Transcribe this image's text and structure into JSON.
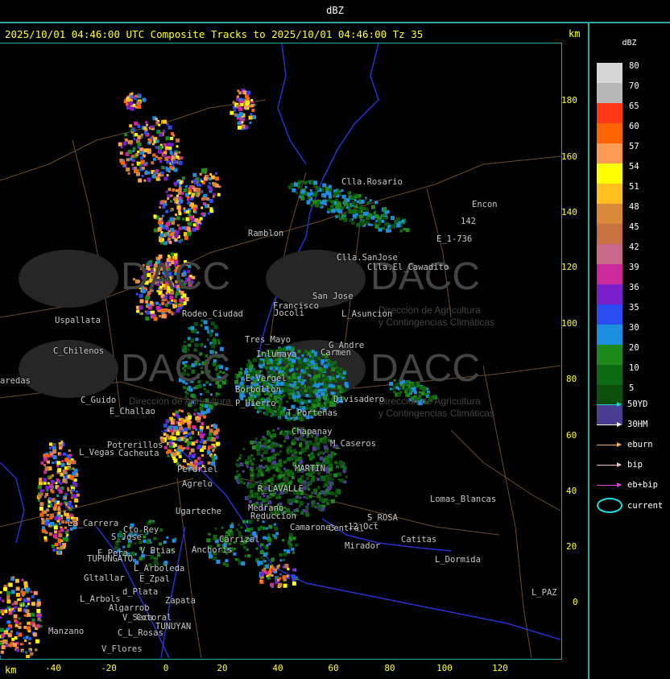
{
  "window": {
    "title": "dBZ"
  },
  "header": {
    "text": "2025/10/01 04:46:00 UTC Composite Tracks to 2025/10/01 04:46:00 Tz 35",
    "km_top": "km",
    "km_bottom": "km"
  },
  "axes": {
    "y_ticks": [
      {
        "label": "180"
      },
      {
        "label": "160"
      },
      {
        "label": "140"
      },
      {
        "label": "120"
      },
      {
        "label": "100"
      },
      {
        "label": "80"
      },
      {
        "label": "60"
      },
      {
        "label": "40"
      },
      {
        "label": "20"
      },
      {
        "label": "0"
      }
    ],
    "x_ticks": [
      {
        "label": "-40"
      },
      {
        "label": "-20"
      },
      {
        "label": "0"
      },
      {
        "label": "20"
      },
      {
        "label": "40"
      },
      {
        "label": "60"
      },
      {
        "label": "80"
      },
      {
        "label": "100"
      },
      {
        "label": "120"
      }
    ]
  },
  "watermark": {
    "brand": "DACC",
    "line1": "Dirección de Agricultura",
    "line2": "y Contingencias Climáticas"
  },
  "places": [
    {
      "name": "Ramblon"
    },
    {
      "name": "Clla.SanJose"
    },
    {
      "name": "Clla.El_Cawadito"
    },
    {
      "name": "E_1-736"
    },
    {
      "name": "Encon"
    },
    {
      "name": "142"
    },
    {
      "name": "Clla.Rosario"
    },
    {
      "name": "Uspallata"
    },
    {
      "name": "C_Chilenos"
    },
    {
      "name": "aredas"
    },
    {
      "name": "C_Guido"
    },
    {
      "name": "E_Challao"
    },
    {
      "name": "Potrerillos"
    },
    {
      "name": "L_Vegas"
    },
    {
      "name": "Cacheuta"
    },
    {
      "name": "Perdriel"
    },
    {
      "name": "Agrelo"
    },
    {
      "name": "Ugarteche"
    },
    {
      "name": "La_Carrera"
    },
    {
      "name": "Cto_Rey"
    },
    {
      "name": "S_Jose"
    },
    {
      "name": "E_Pera"
    },
    {
      "name": "TUPUNGATO"
    },
    {
      "name": "V_Btias"
    },
    {
      "name": "Anchoris"
    },
    {
      "name": "L_Arboleda"
    },
    {
      "name": "Gltallar"
    },
    {
      "name": "E_Zpal"
    },
    {
      "name": "L_Arbols"
    },
    {
      "name": "d_Plata"
    },
    {
      "name": "Zapata"
    },
    {
      "name": "Algarrob"
    },
    {
      "name": "V_Seca"
    },
    {
      "name": "Cotoral"
    },
    {
      "name": "TUNUYAN"
    },
    {
      "name": "Manzano"
    },
    {
      "name": "C_L_Rosas"
    },
    {
      "name": "V_Flores"
    },
    {
      "name": "San Jose"
    },
    {
      "name": "L_Asuncion"
    },
    {
      "name": "Francisco"
    },
    {
      "name": "Tres_Mayo"
    },
    {
      "name": "Jocoli"
    },
    {
      "name": "Inlumaya"
    },
    {
      "name": "G_Andre"
    },
    {
      "name": "Carmen"
    },
    {
      "name": "E_Vergel"
    },
    {
      "name": "Borbollon"
    },
    {
      "name": "P_Hierro"
    },
    {
      "name": "Divisadero"
    },
    {
      "name": "T_Porteñas"
    },
    {
      "name": "Chapanay"
    },
    {
      "name": "M_Caseros"
    },
    {
      "name": "MARTIN"
    },
    {
      "name": "R_LAVALLE"
    },
    {
      "name": "Medrano"
    },
    {
      "name": "Reduccion"
    },
    {
      "name": "Camarones"
    },
    {
      "name": "Central"
    },
    {
      "name": "12_Oct"
    },
    {
      "name": "S_ROSA"
    },
    {
      "name": "Lomas_Blancas"
    },
    {
      "name": "Catitas"
    },
    {
      "name": "Carrizal"
    },
    {
      "name": "Mirador"
    },
    {
      "name": "L_Dormida"
    },
    {
      "name": "L_PAZ"
    },
    {
      "name": "Rodeo_Ciudad"
    }
  ],
  "legend": {
    "title": "dBZ",
    "colorbar": [
      {
        "label": "80",
        "color": "#d6d6d6"
      },
      {
        "label": "70",
        "color": "#b9b9b9"
      },
      {
        "label": "65",
        "color": "#ff3a1a"
      },
      {
        "label": "60",
        "color": "#ff6400"
      },
      {
        "label": "57",
        "color": "#ff9a55"
      },
      {
        "label": "54",
        "color": "#ffff00"
      },
      {
        "label": "51",
        "color": "#ffc020"
      },
      {
        "label": "48",
        "color": "#d88a3a"
      },
      {
        "label": "45",
        "color": "#c87040"
      },
      {
        "label": "42",
        "color": "#c8688a"
      },
      {
        "label": "39",
        "color": "#cc2a9a"
      },
      {
        "label": "36",
        "color": "#7a20c8"
      },
      {
        "label": "35",
        "color": "#2a4cf0"
      },
      {
        "label": "30",
        "color": "#1e8ee0"
      },
      {
        "label": "20",
        "color": "#1e8a1e"
      },
      {
        "label": "10",
        "color": "#0e6a12"
      },
      {
        "label": "5",
        "color": "#0c4e0c"
      },
      {
        "label": "",
        "color": "#4a3c90"
      }
    ],
    "tracks": [
      {
        "label": "50YD",
        "color": "#22d0d0"
      },
      {
        "label": "30HM",
        "color": "#ffffff"
      },
      {
        "label": "eburn",
        "color": "#f0b060"
      },
      {
        "label": "bip",
        "color": "#f0c0d0"
      },
      {
        "label": "eb+bip",
        "color": "#e040e0"
      }
    ],
    "current": {
      "label": "current",
      "color": "#22e0e0"
    }
  }
}
